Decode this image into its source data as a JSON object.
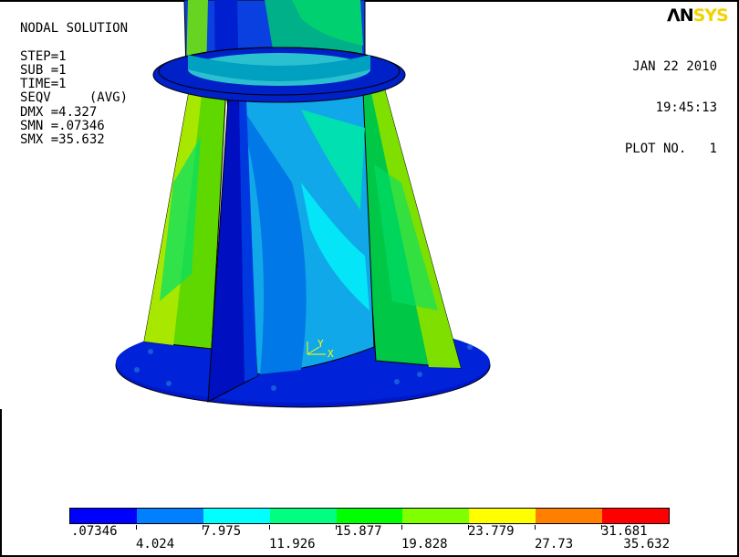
{
  "header": {
    "lines": [
      "NODAL SOLUTION",
      "",
      "STEP=1",
      "SUB =1",
      "TIME=1",
      "SEQV     (AVG)",
      "DMX =4.327",
      "SMN =.07346",
      "SMX =35.632"
    ],
    "logo_left": "ΛN",
    "logo_right": "SYS",
    "date": "JAN 22 2010",
    "time": "19:45:13",
    "plot_no": "PLOT NO.   1"
  },
  "triad": {
    "y_label": "Y",
    "x_label": "X"
  },
  "legend": {
    "colors": [
      "#0000ff",
      "#0080ff",
      "#00ffff",
      "#00ff80",
      "#00ff00",
      "#80ff00",
      "#ffff00",
      "#ff8000",
      "#ff0000"
    ],
    "labels_top": [
      ".07346",
      "7.975",
      "15.877",
      "23.779",
      "31.681"
    ],
    "labels_bottom": [
      "4.024",
      "11.926",
      "19.828",
      "27.73",
      "35.632"
    ]
  },
  "colors": {
    "min": "#0000ff",
    "max": "#ff0000",
    "logo_accent": "#f2d200"
  }
}
